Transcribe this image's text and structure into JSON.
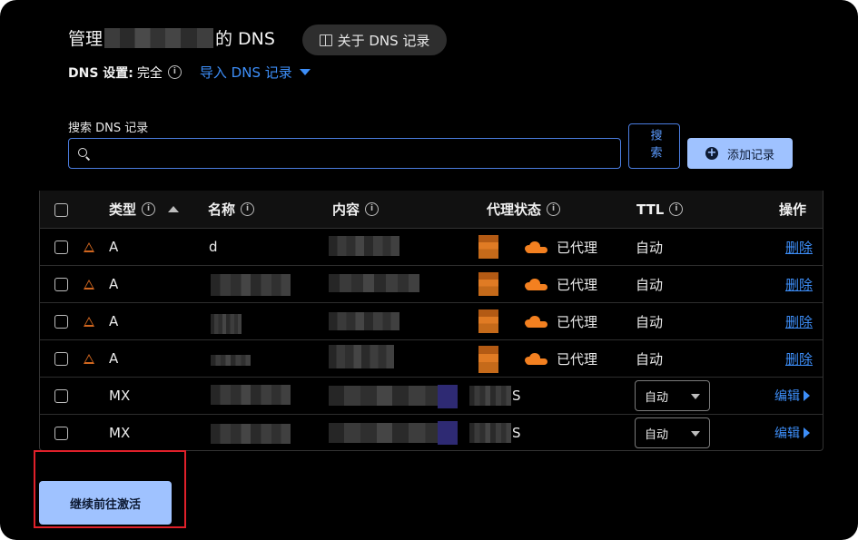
{
  "header": {
    "title_prefix": "管理",
    "title_suffix": "的 DNS",
    "about_button": "关于 DNS 记录",
    "settings_label": "DNS 设置:",
    "settings_value": "完全",
    "import_link": "导入 DNS 记录"
  },
  "search": {
    "label": "搜索 DNS 记录",
    "placeholder": "",
    "button": "搜索",
    "add_button": "添加记录"
  },
  "table": {
    "columns": [
      "类型",
      "名称",
      "内容",
      "代理状态",
      "TTL",
      "操作"
    ],
    "rows": [
      {
        "type": "A",
        "name": "d",
        "proxy": "已代理",
        "ttl": "自动",
        "action": "删除",
        "warning": true
      },
      {
        "type": "A",
        "name": "",
        "proxy": "已代理",
        "ttl": "自动",
        "action": "删除",
        "warning": true
      },
      {
        "type": "A",
        "name": "",
        "proxy": "已代理",
        "ttl": "自动",
        "action": "删除",
        "warning": true
      },
      {
        "type": "A",
        "name": "",
        "proxy": "已代理",
        "ttl": "自动",
        "action": "删除",
        "warning": true
      },
      {
        "type": "MX",
        "name": "",
        "proxy_tail": "S",
        "ttl": "自动",
        "action": "编辑",
        "warning": false
      },
      {
        "type": "MX",
        "name": "",
        "proxy_tail": "S",
        "ttl": "自动",
        "action": "编辑",
        "warning": false
      }
    ]
  },
  "footer": {
    "continue_button": "继续前往激活"
  },
  "colors": {
    "accent": "#3d8ef8",
    "button_fill": "#9fc2ff",
    "proxy_orange": "#f38020",
    "highlight_red": "#e0202a"
  }
}
